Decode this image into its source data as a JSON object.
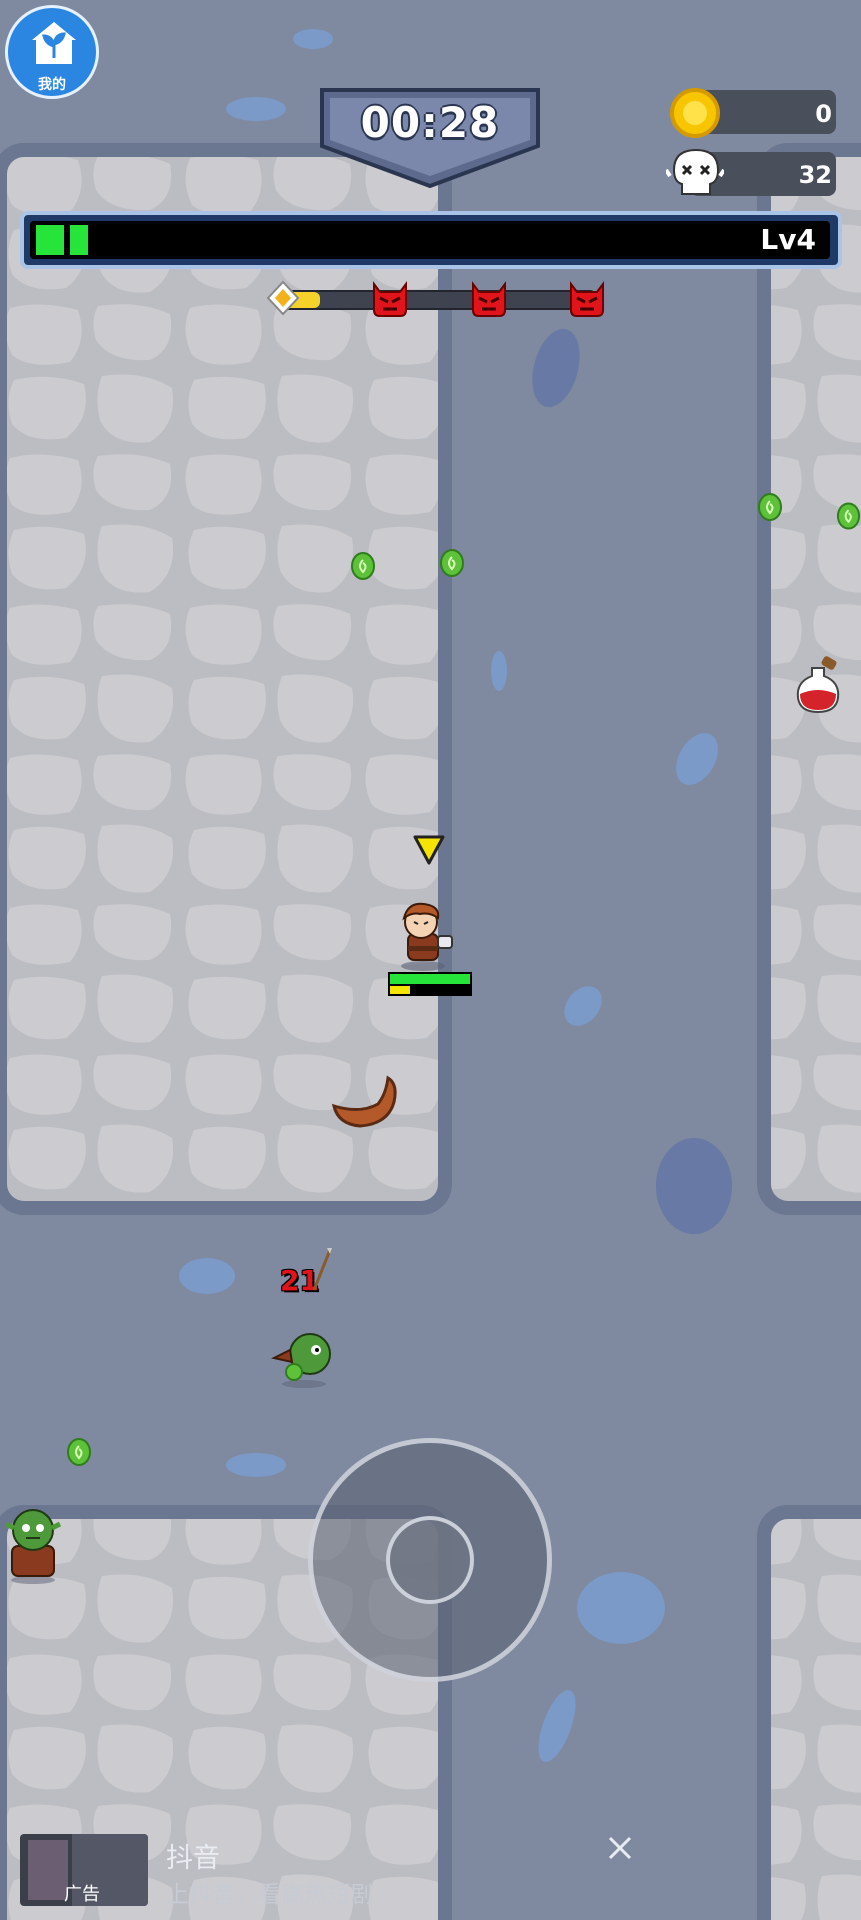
{
  "hud": {
    "home_label": "我的",
    "timer": "00:28",
    "coins": "0",
    "kills": "32",
    "level_label": "Lv4",
    "xp_progress": 0.09
  },
  "wave_markers": [
    "start-marker",
    "boss-marker",
    "boss-marker",
    "boss-marker"
  ],
  "player": {
    "health": 1.0,
    "experience": 0.25
  },
  "combat": {
    "damage_number": "21"
  },
  "ad_banner": {
    "title": "抖音",
    "subtitle": "上抖音，看高热短剧",
    "tag": "广告",
    "close_icon": "close-icon"
  },
  "colors": {
    "floor_stone": "#c3c3c9",
    "road": "#7f8aa0",
    "xp_green": "#27e43a",
    "coin_gold": "#f7c600",
    "boss_red": "#e0141a",
    "player_indicator": "#f5e400"
  }
}
